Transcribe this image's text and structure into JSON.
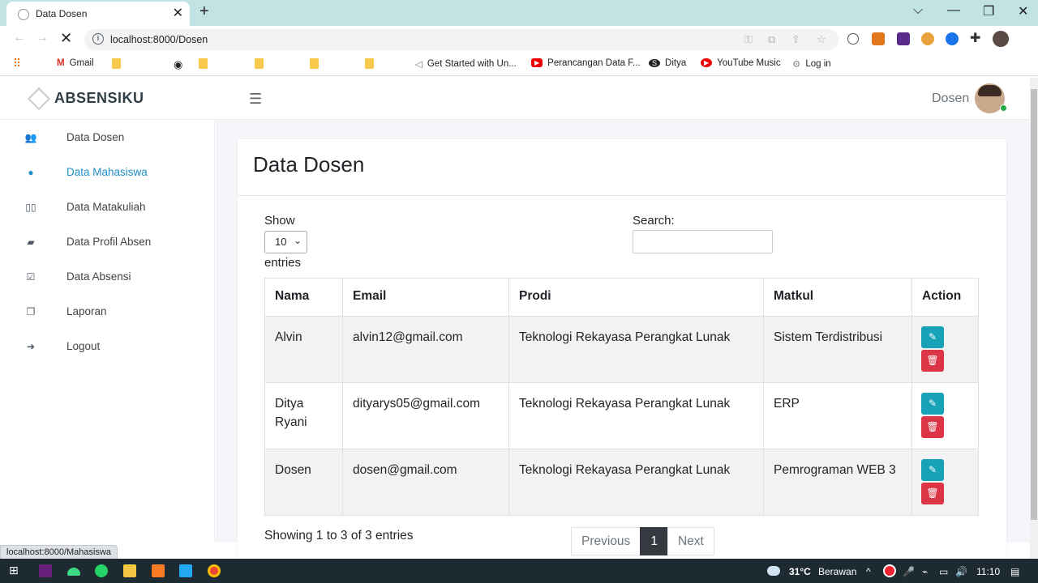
{
  "browser": {
    "tab_title": "Data Dosen",
    "tab_close": "✕",
    "new_tab": "+",
    "url": "localhost:8000/Dosen",
    "window_controls": {
      "minimize": "⌵",
      "min": "—",
      "restore": "❐",
      "close": "✕"
    },
    "bookmarks": [
      {
        "label": "Gmail",
        "icon": "gmail-icon"
      },
      {
        "label": "",
        "icon": "folder-icon"
      },
      {
        "label": "",
        "icon": "globe-icon"
      },
      {
        "label": "",
        "icon": "folder-icon"
      },
      {
        "label": "",
        "icon": "folder-icon"
      },
      {
        "label": "",
        "icon": "folder-icon"
      },
      {
        "label": "",
        "icon": "folder-icon"
      },
      {
        "label": "Get Started with Un...",
        "icon": "send-icon"
      },
      {
        "label": "Perancangan Data F...",
        "icon": "youtube-icon"
      },
      {
        "label": "Ditya",
        "icon": "s-icon"
      },
      {
        "label": "YouTube Music",
        "icon": "youtube-music-icon"
      },
      {
        "label": "Log in",
        "icon": "gear-icon"
      }
    ]
  },
  "app": {
    "brand": "ABSENSIKU",
    "user_name": "Dosen",
    "sidebar": [
      {
        "label": "Data Dosen",
        "icon": "users-icon",
        "active": false
      },
      {
        "label": "Data Mahasiswa",
        "icon": "user-icon",
        "active": true
      },
      {
        "label": "Data Matakuliah",
        "icon": "book-open-icon",
        "active": false
      },
      {
        "label": "Data Profil Absen",
        "icon": "book-icon",
        "active": false
      },
      {
        "label": "Data Absensi",
        "icon": "check-square-icon",
        "active": false
      },
      {
        "label": "Laporan",
        "icon": "copy-icon",
        "active": false
      },
      {
        "label": "Logout",
        "icon": "sign-in-icon",
        "active": false
      }
    ],
    "page_title": "Data Dosen",
    "show_label": "Show",
    "page_size": "10",
    "entries_label": "entries",
    "search_label": "Search:",
    "search_value": "",
    "table": {
      "columns": [
        "Nama",
        "Email",
        "Prodi",
        "Matkul",
        "Action"
      ],
      "rows": [
        {
          "nama": "Alvin",
          "email": "alvin12@gmail.com",
          "prodi": "Teknologi Rekayasa Perangkat Lunak",
          "matkul": "Sistem Terdistribusi"
        },
        {
          "nama": "Ditya Ryani",
          "email": "dityarys05@gmail.com",
          "prodi": "Teknologi Rekayasa Perangkat Lunak",
          "matkul": "ERP"
        },
        {
          "nama": "Dosen",
          "email": "dosen@gmail.com",
          "prodi": "Teknologi Rekayasa Perangkat Lunak",
          "matkul": "Pemrograman WEB 3"
        }
      ]
    },
    "info": "Showing 1 to 3 of 3 entries",
    "pagination": {
      "previous": "Previous",
      "current": "1",
      "next": "Next"
    },
    "status_url": "localhost:8000/Mahasiswa"
  },
  "taskbar": {
    "temperature": "31°C",
    "weather": "Berawan",
    "time": "11:10"
  },
  "colors": {
    "accent": "#1f8fc7",
    "edit": "#17a2b8",
    "delete": "#dc3545",
    "active_page": "#343a40"
  }
}
